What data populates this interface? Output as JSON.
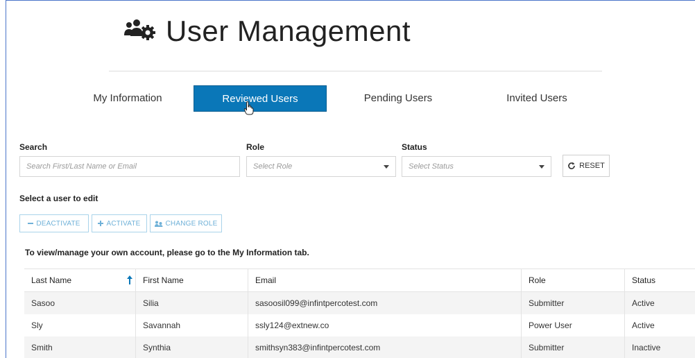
{
  "header": {
    "title": "User Management",
    "icon": "users-gear-icon"
  },
  "tabs": [
    {
      "label": "My Information",
      "active": false
    },
    {
      "label": "Reviewed Users",
      "active": true
    },
    {
      "label": "Pending Users",
      "active": false
    },
    {
      "label": "Invited Users",
      "active": false
    }
  ],
  "filters": {
    "search_label": "Search",
    "search_placeholder": "Search First/Last Name or Email",
    "role_label": "Role",
    "role_placeholder": "Select Role",
    "status_label": "Status",
    "status_placeholder": "Select Status",
    "reset_label": "RESET"
  },
  "actions": {
    "prompt": "Select a user to edit",
    "deactivate": "DEACTIVATE",
    "activate": "ACTIVATE",
    "change_role": "CHANGE ROLE"
  },
  "note": "To view/manage your own account, please go to the My Information tab.",
  "table": {
    "columns": [
      "Last Name",
      "First Name",
      "Email",
      "Role",
      "Status"
    ],
    "rows": [
      [
        "Sasoo",
        "Silia",
        "sasoosil099@infintpercotest.com",
        "Submitter",
        "Active"
      ],
      [
        "Sly",
        "Savannah",
        "ssly124@extnew.co",
        "Power User",
        "Active"
      ],
      [
        "Smith",
        "Synthia",
        "smithsyn383@infintpercotest.com",
        "Submitter",
        "Inactive"
      ]
    ]
  },
  "colors": {
    "accent": "#0a77b8",
    "action_text": "#6fb1d8",
    "frame_border": "#4a74c9"
  }
}
